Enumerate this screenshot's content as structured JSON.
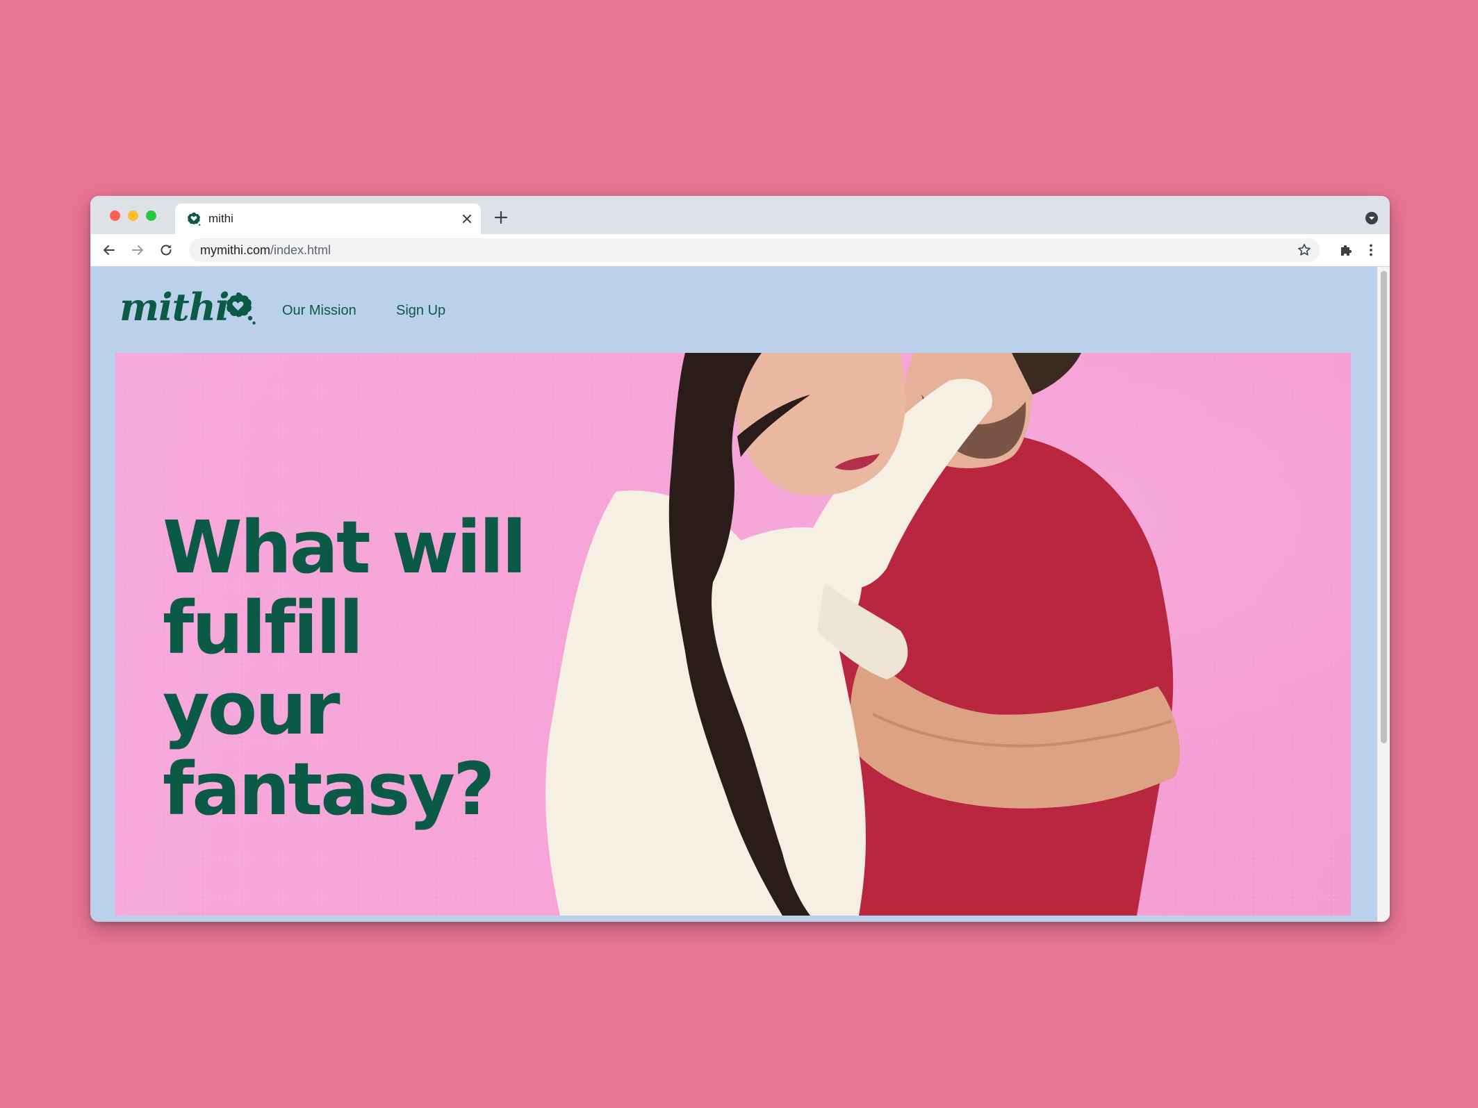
{
  "browser": {
    "tab_title": "mithi",
    "url_domain": "mymithi.com",
    "url_path": "/index.html"
  },
  "site": {
    "logo_text": "mithi",
    "nav": [
      {
        "label": "Our Mission"
      },
      {
        "label": "Sign Up"
      }
    ],
    "hero": {
      "headline": "What will fulfill your fantasy?"
    }
  },
  "colors": {
    "page_background": "#EA7594",
    "site_background": "#BBD0EB",
    "brand_green": "#0B5A45",
    "hero_pink": "#F5A2D6",
    "sweater_cream": "#F6EFE4",
    "tshirt_red": "#B8273F"
  },
  "icons": {
    "favicon": "mithi-heart-cloud-icon",
    "tab_close": "close-icon",
    "new_tab": "plus-icon",
    "profile": "chevron-down-circle-icon",
    "back": "arrow-left-icon",
    "forward": "arrow-right-icon",
    "reload": "reload-icon",
    "bookmark": "star-icon",
    "extensions": "puzzle-icon",
    "menu": "kebab-menu-icon"
  }
}
